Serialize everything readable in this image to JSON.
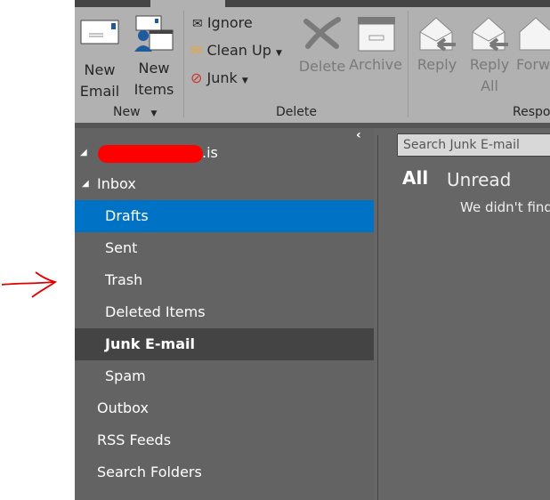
{
  "ribbon": {
    "new_email": [
      "New",
      "Email"
    ],
    "new_items": [
      "New",
      "Items"
    ],
    "ignore": "Ignore",
    "clean_up": "Clean Up",
    "junk": "Junk",
    "delete": "Delete",
    "archive": "Archive",
    "reply": "Reply",
    "reply_all": [
      "Reply",
      "All"
    ],
    "forward": "Forw",
    "groups": {
      "new": "New",
      "delete": "Delete",
      "respond": "Respo"
    }
  },
  "folders": {
    "account": ".is",
    "items": [
      {
        "label": "Inbox",
        "level": 0,
        "expanded": true
      },
      {
        "label": "Drafts",
        "level": 1,
        "state": "hover"
      },
      {
        "label": "Sent",
        "level": 1
      },
      {
        "label": "Trash",
        "level": 1
      },
      {
        "label": "Deleted Items",
        "level": 1
      },
      {
        "label": "Junk E-mail",
        "level": 1,
        "state": "selected"
      },
      {
        "label": "Spam",
        "level": 1
      },
      {
        "label": "Outbox",
        "level": 0
      },
      {
        "label": "RSS Feeds",
        "level": 0
      },
      {
        "label": "Search Folders",
        "level": 0
      }
    ]
  },
  "search": {
    "placeholder": "Search Junk E-mail"
  },
  "filters": {
    "all": "All",
    "unread": "Unread"
  },
  "empty_message": "We didn't find",
  "colors": {
    "accent": "#0072c6",
    "annotation": "#e00000"
  }
}
